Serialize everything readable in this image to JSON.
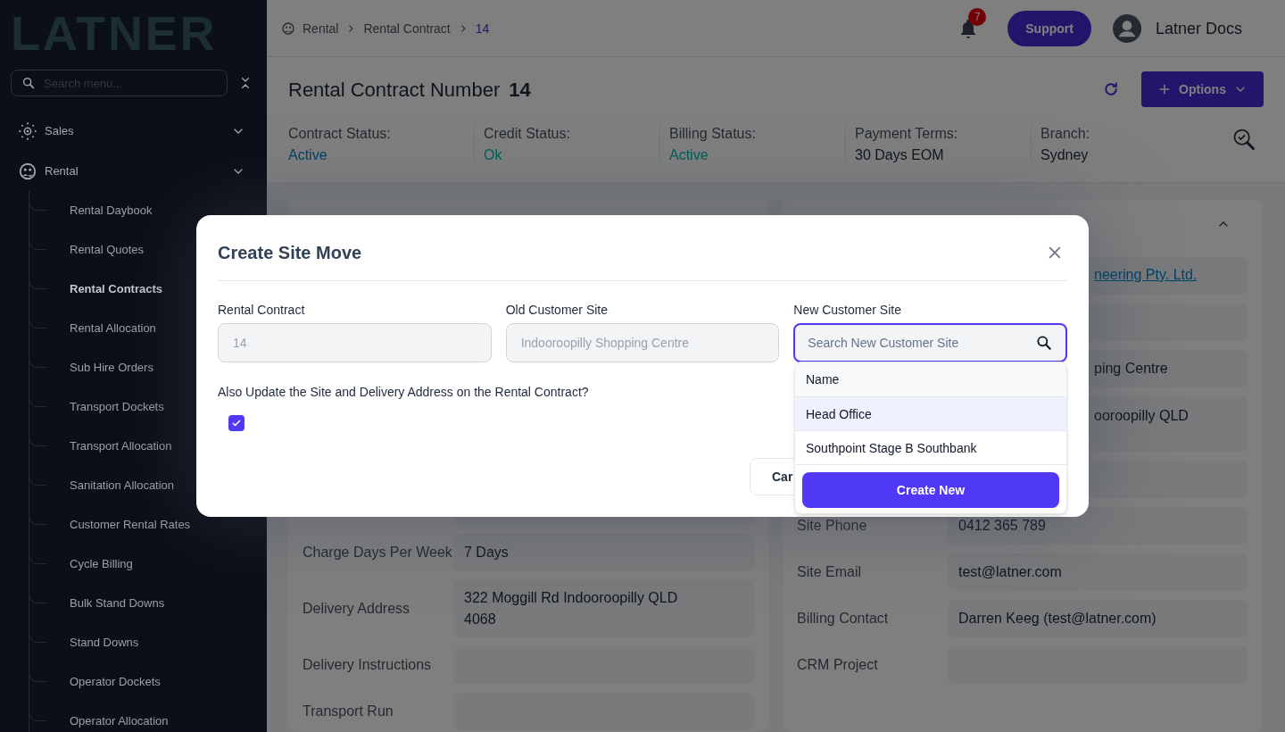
{
  "sidebar": {
    "logo": "LATNER",
    "search": {
      "placeholder": "Search menu..."
    },
    "groups": [
      {
        "label": "Sales",
        "kind": "sales"
      },
      {
        "label": "Rental",
        "kind": "rental",
        "children": [
          {
            "label": "Rental Daybook",
            "selected": false
          },
          {
            "label": "Rental Quotes",
            "selected": false
          },
          {
            "label": "Rental Contracts",
            "selected": true
          },
          {
            "label": "Rental Allocation",
            "selected": false
          },
          {
            "label": "Sub Hire Orders",
            "selected": false
          },
          {
            "label": "Transport Dockets",
            "selected": false
          },
          {
            "label": "Transport Allocation",
            "selected": false
          },
          {
            "label": "Sanitation Allocation",
            "selected": false
          },
          {
            "label": "Customer Rental Rates",
            "selected": false
          },
          {
            "label": "Cycle Billing",
            "selected": false
          },
          {
            "label": "Bulk Stand Downs",
            "selected": false
          },
          {
            "label": "Stand Downs",
            "selected": false
          },
          {
            "label": "Operator Dockets",
            "selected": false
          },
          {
            "label": "Operator Allocation",
            "selected": false
          }
        ]
      }
    ]
  },
  "header": {
    "breadcrumb": [
      "Rental",
      "Rental Contract",
      "14"
    ],
    "notifications": "7",
    "support": "Support",
    "user": "Latner Docs"
  },
  "contract": {
    "title": "Rental Contract Number",
    "number": "14",
    "options": "Options",
    "statuses": [
      {
        "label": "Contract Status:",
        "value": "Active",
        "kind": "info"
      },
      {
        "label": "Credit Status:",
        "value": "Ok",
        "kind": "success"
      },
      {
        "label": "Billing Status:",
        "value": "Active",
        "kind": "success"
      },
      {
        "label": "Payment Terms:",
        "value": "30 Days EOM",
        "kind": "plain"
      },
      {
        "label": "Branch:",
        "value": "Sydney",
        "kind": "plain"
      }
    ]
  },
  "left_card": {
    "rows": [
      {
        "kind": "blank"
      },
      {
        "kind": "text",
        "label": "Charge Days Per Week",
        "value": "7 Days"
      },
      {
        "kind": "text",
        "label": "Delivery Address",
        "value": "322 Moggill Rd Indooroopilly QLD 4068"
      },
      {
        "kind": "text",
        "label": "Delivery Instructions"
      },
      {
        "kind": "text",
        "label": "Transport Run"
      }
    ]
  },
  "right_card": {
    "rows": [
      {
        "kind": "link",
        "value": "neering Pty. Ltd."
      },
      {
        "kind": "blank"
      },
      {
        "kind": "partial",
        "value": "ping Centre"
      },
      {
        "kind": "wrapped",
        "value": "ooroopilly QLD"
      },
      {
        "kind": "blank"
      },
      {
        "kind": "text",
        "label": "Site Phone",
        "value": "0412 365 789"
      },
      {
        "kind": "text",
        "label": "Site Email",
        "value": "test@latner.com"
      },
      {
        "kind": "text",
        "label": "Billing Contact",
        "value": "Darren Keeg (test@latner.com)"
      },
      {
        "kind": "text",
        "label": "CRM Project"
      }
    ]
  },
  "modal": {
    "title": "Create Site Move",
    "fields": [
      {
        "label": "Rental Contract",
        "value": "14",
        "disabled": true
      },
      {
        "label": "Old Customer Site",
        "value": "Indooroopilly Shopping Centre",
        "disabled": true
      }
    ],
    "new_site": {
      "label": "New Customer Site",
      "placeholder": "Search New Customer Site"
    },
    "question": "Also Update the Site and Delivery Address on the Rental Contract?",
    "checked": true,
    "cancel": "Car",
    "dropdown": {
      "header": "Name",
      "options": [
        {
          "label": "Head Office",
          "selected": true
        },
        {
          "label": "Southpoint Stage B Southbank",
          "selected": false
        }
      ],
      "create": "Create New"
    }
  }
}
